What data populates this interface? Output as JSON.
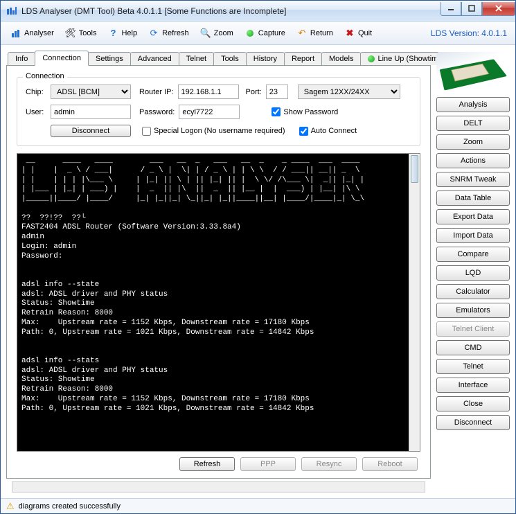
{
  "titlebar": {
    "text": "LDS Analyser (DMT Tool) Beta 4.0.1.1 [Some Functions are Incomplete]"
  },
  "toolbar": {
    "analyser": "Analyser",
    "tools": "Tools",
    "help": "Help",
    "refresh": "Refresh",
    "zoom": "Zoom",
    "capture": "Capture",
    "return": "Return",
    "quit": "Quit",
    "version": "LDS Version: 4.0.1.1"
  },
  "tabs": [
    "Info",
    "Connection",
    "Settings",
    "Advanced",
    "Telnet",
    "Tools",
    "History",
    "Report",
    "Models"
  ],
  "showtime_tab": "Line Up (Showtime)",
  "active_tab": 1,
  "connection": {
    "group_title": "Connection",
    "chip_label": "Chip:",
    "chip_value": "ADSL [BCM]",
    "router_ip_label": "Router IP:",
    "router_ip_value": "192.168.1.1",
    "port_label": "Port:",
    "port_value": "23",
    "modem_value": "Sagem 12XX/24XX",
    "user_label": "User:",
    "user_value": "admin",
    "password_label": "Password:",
    "password_value": "ecyl7722",
    "show_password_label": "Show Password",
    "show_password_checked": true,
    "disconnect_btn": "Disconnect",
    "special_logon_label": "Special Logon (No username required)",
    "special_logon_checked": false,
    "auto_connect_label": "Auto Connect",
    "auto_connect_checked": true
  },
  "terminal_text": " __      ____   ____        ___   __  _   ___   __  _    _ ____  ___  ____\n| |    |  _ \\ / ___|      / _ \\ |  \\| | / _ \\ | | \\ \\  / / ___|| __|| _  \\\n| |    | | | |\\___ \\     | |_| || \\ | || |_| || |  \\ \\/ /\\___ \\|  _|| |_| |\n| |___ | |_| | ___) |    |  _  || |\\  ||  _  || |__ |  |  ___) | |__| |\\ \\\n|_____||____/ |____/     |_| |_||_| \\_||_| |_||____||__| |____/|____|_| \\_\\\n\n??  ??!??  ??└\nFAST2404 ADSL Router (Software Version:3.33.8a4)\nadmin\nLogin: admin\nPassword:\n\n\nadsl info --state\nadsl: ADSL driver and PHY status\nStatus: Showtime\nRetrain Reason: 8000\nMax:    Upstream rate = 1152 Kbps, Downstream rate = 17180 Kbps\nPath: 0, Upstream rate = 1021 Kbps, Downstream rate = 14842 Kbps\n\n\nadsl info --stats\nadsl: ADSL driver and PHY status\nStatus: Showtime\nRetrain Reason: 8000\nMax:    Upstream rate = 1152 Kbps, Downstream rate = 17180 Kbps\nPath: 0, Upstream rate = 1021 Kbps, Downstream rate = 14842 Kbps",
  "bottom_buttons": {
    "refresh": "Refresh",
    "ppp": "PPP",
    "resync": "Resync",
    "reboot": "Reboot"
  },
  "side_buttons": [
    "Analysis",
    "DELT",
    "Zoom",
    "Actions",
    "SNRM Tweak",
    "Data Table",
    "Export Data",
    "Import Data",
    "Compare",
    "LQD",
    "Calculator",
    "Emulators",
    "Telnet Client",
    "CMD",
    "Telnet",
    "Interface",
    "Close",
    "Disconnect"
  ],
  "side_disabled_index": 12,
  "statusbar": {
    "text": "diagrams created successfully"
  }
}
